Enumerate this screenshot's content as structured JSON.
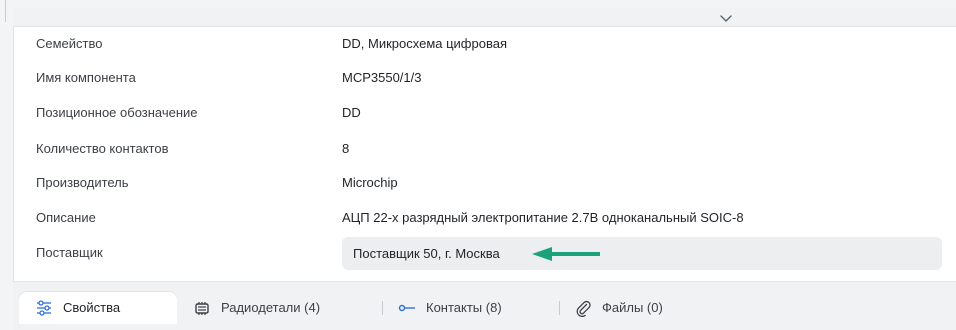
{
  "properties": [
    {
      "label": "Семейство",
      "value": "DD, Микросхема цифровая"
    },
    {
      "label": "Имя компонента",
      "value": "MCP3550/1/3"
    },
    {
      "label": "Позиционное обозначение",
      "value": "DD"
    },
    {
      "label": "Количество контактов",
      "value": "8"
    },
    {
      "label": "Производитель",
      "value": "Microchip"
    },
    {
      "label": "Описание",
      "value": "АЦП 22-х разрядный электропитание 2.7В одноканальный SOIC-8"
    },
    {
      "label": "Поставщик",
      "value": "Поставщик 50, г. Москва"
    }
  ],
  "tabs": [
    {
      "label": "Свойства",
      "icon": "sliders-icon",
      "active": true
    },
    {
      "label": "Радиодетали (4)",
      "icon": "chip-icon",
      "active": false
    },
    {
      "label": "Контакты (8)",
      "icon": "pin-icon",
      "active": false
    },
    {
      "label": "Файлы (0)",
      "icon": "paperclip-icon",
      "active": false
    }
  ],
  "colors": {
    "accent_arrow": "#1aa37a",
    "highlight_bg": "#eceef0"
  }
}
